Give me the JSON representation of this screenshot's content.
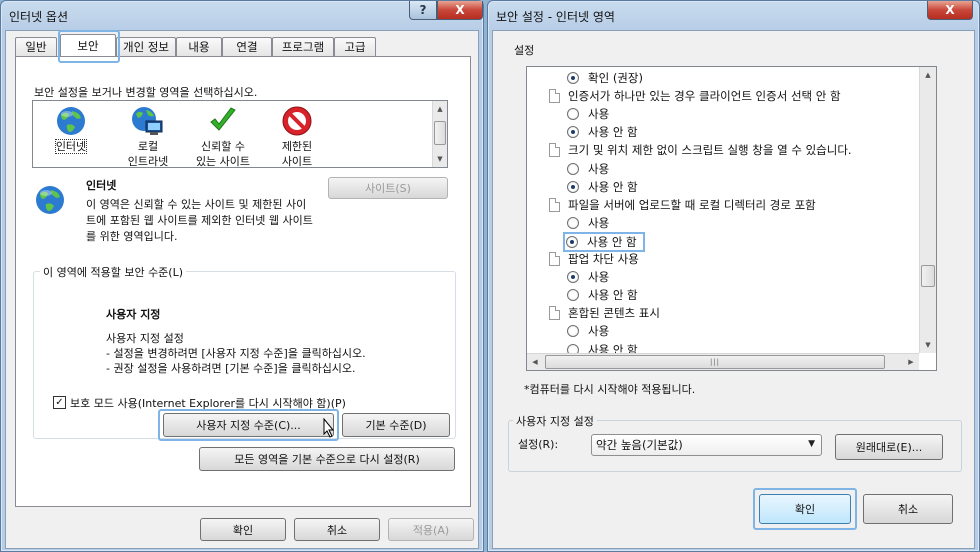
{
  "left_window": {
    "title": "인터넷 옵션",
    "help": "?",
    "close": "X",
    "tabs": [
      {
        "label": "일반",
        "active": false
      },
      {
        "label": "보안",
        "active": true
      },
      {
        "label": "개인 정보",
        "active": false
      },
      {
        "label": "내용",
        "active": false
      },
      {
        "label": "연결",
        "active": false
      },
      {
        "label": "프로그램",
        "active": false
      },
      {
        "label": "고급",
        "active": false
      }
    ],
    "instruction": "보안 설정을 보거나 변경할 영역을 선택하십시오.",
    "zones": [
      {
        "label": "인터넷",
        "icon": "globe-icon"
      },
      {
        "label": "로컬\n인트라넷",
        "icon": "intranet-icon"
      },
      {
        "label": "신뢰할 수\n있는 사이트",
        "icon": "checkmark-icon"
      },
      {
        "label": "제한된\n사이트",
        "icon": "no-entry-icon"
      }
    ],
    "zone_title": "인터넷",
    "zone_desc": [
      "이 영역은 신뢰할 수 있는 사이트 및 제한된 사이",
      "트에 포함된 웹 사이트를 제외한 인터넷 웹 사이트",
      "를 위한 영역입니다."
    ],
    "sites_button": "사이트(S)",
    "group_title": "이 영역에 적용할 보안 수준(L)",
    "level_title": "사용자 지정",
    "level_lines": [
      "사용자 지정 설정",
      "- 설정을 변경하려면 [사용자 지정 수준]을 클릭하십시오.",
      "- 권장 설정을 사용하려면 [기본 수준]을 클릭하십시오."
    ],
    "protected_mode": "보호 모드 사용(Internet Explorer를 다시 시작해야 함)(P)",
    "protected_checked": "✓",
    "custom_level_button": "사용자 지정 수준(C)...",
    "default_level_button": "기본 수준(D)",
    "reset_all_button": "모든 영역을 기본 수준으로 다시 설정(R)",
    "ok": "확인",
    "cancel": "취소",
    "apply": "적용(A)"
  },
  "right_window": {
    "title": "보안 설정 - 인터넷 영역",
    "close": "X",
    "settings_label": "설정",
    "items": [
      {
        "type": "radio",
        "label": "확인 (권장)",
        "checked": true
      },
      {
        "type": "header",
        "label": "인증서가 하나만 있는 경우 클라이언트 인증서 선택 안 함"
      },
      {
        "type": "radio",
        "label": "사용",
        "checked": false
      },
      {
        "type": "radio",
        "label": "사용 안 함",
        "checked": true
      },
      {
        "type": "header",
        "label": "크기 및 위치 제한 없이 스크립트 실행 창을 열 수 있습니다."
      },
      {
        "type": "radio",
        "label": "사용",
        "checked": false
      },
      {
        "type": "radio",
        "label": "사용 안 함",
        "checked": true
      },
      {
        "type": "header",
        "label": "파일을 서버에 업로드할 때 로컬 디렉터리 경로 포함"
      },
      {
        "type": "radio",
        "label": "사용",
        "checked": false
      },
      {
        "type": "radio",
        "label": "사용 안 함",
        "checked": true,
        "focused": true
      },
      {
        "type": "header",
        "label": "팝업 차단 사용"
      },
      {
        "type": "radio",
        "label": "사용",
        "checked": true
      },
      {
        "type": "radio",
        "label": "사용 안 함",
        "checked": false
      },
      {
        "type": "header",
        "label": "혼합된 콘텐츠 표시"
      },
      {
        "type": "radio",
        "label": "사용",
        "checked": false
      },
      {
        "type": "radio",
        "label": "사용 안 함",
        "checked": false
      }
    ],
    "restart_note": "*컴퓨터를 다시 시작해야 적용됩니다.",
    "custom_group": "사용자 지정 설정",
    "reset_label": "설정(R):",
    "reset_value": "약간 높음(기본값)",
    "reset_button": "원래대로(E)...",
    "ok": "확인",
    "cancel": "취소"
  }
}
